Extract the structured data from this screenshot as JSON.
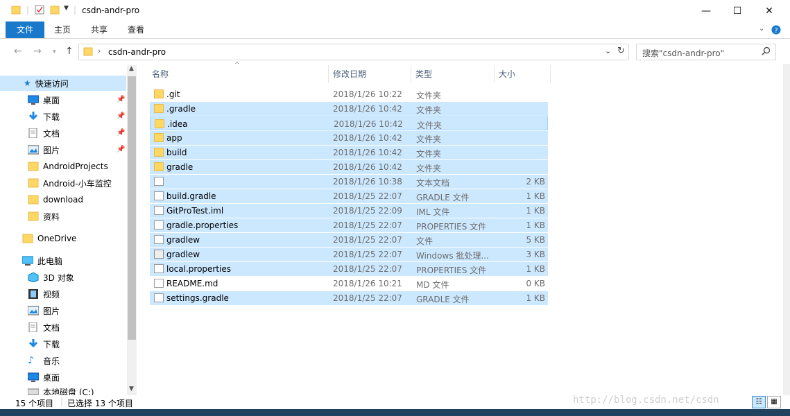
{
  "window": {
    "title": "csdn-andr-pro"
  },
  "title_buttons": {
    "minimize": "—",
    "maximize": "☐",
    "close": "✕"
  },
  "ribbon": {
    "tabs": [
      "文件",
      "主页",
      "共享",
      "查看"
    ]
  },
  "address": {
    "path_label": "csdn-andr-pro",
    "search_placeholder": "搜索\"csdn-andr-pro\""
  },
  "nav": {
    "quick_access": "快速访问",
    "items": [
      {
        "label": "桌面",
        "icon": "desktop-icon",
        "pinned": true
      },
      {
        "label": "下载",
        "icon": "download-icon",
        "pinned": true
      },
      {
        "label": "文档",
        "icon": "documents-icon",
        "pinned": true
      },
      {
        "label": "图片",
        "icon": "pictures-icon",
        "pinned": true
      },
      {
        "label": "AndroidProjects",
        "icon": "folder-icon",
        "pinned": false
      },
      {
        "label": "Android-小车监控",
        "icon": "folder-icon",
        "pinned": false
      },
      {
        "label": "download",
        "icon": "folder-icon",
        "pinned": false
      },
      {
        "label": "资料",
        "icon": "folder-icon",
        "pinned": false
      }
    ],
    "onedrive": "OneDrive",
    "this_pc": "此电脑",
    "pc_items": [
      {
        "label": "3D 对象",
        "icon": "3d-objects-icon"
      },
      {
        "label": "视频",
        "icon": "video-icon"
      },
      {
        "label": "图片",
        "icon": "pictures-icon"
      },
      {
        "label": "文档",
        "icon": "documents-icon"
      },
      {
        "label": "下载",
        "icon": "download-icon"
      },
      {
        "label": "音乐",
        "icon": "music-icon"
      },
      {
        "label": "桌面",
        "icon": "desktop-icon"
      },
      {
        "label": "本地磁盘 (C:)",
        "icon": "drive-icon"
      }
    ]
  },
  "columns": {
    "name": "名称",
    "modified": "修改日期",
    "type": "类型",
    "size": "大小"
  },
  "files": [
    {
      "name": ".git",
      "date": "2018/1/26 10:22",
      "type": "文件夹",
      "size": "",
      "icon": "folder",
      "state": ""
    },
    {
      "name": ".gradle",
      "date": "2018/1/26 10:42",
      "type": "文件夹",
      "size": "",
      "icon": "folder",
      "state": "sel"
    },
    {
      "name": ".idea",
      "date": "2018/1/26 10:42",
      "type": "文件夹",
      "size": "",
      "icon": "folder",
      "state": "focus"
    },
    {
      "name": "app",
      "date": "2018/1/26 10:42",
      "type": "文件夹",
      "size": "",
      "icon": "folder",
      "state": "sel"
    },
    {
      "name": "build",
      "date": "2018/1/26 10:42",
      "type": "文件夹",
      "size": "",
      "icon": "folder",
      "state": "sel"
    },
    {
      "name": "gradle",
      "date": "2018/1/26 10:42",
      "type": "文件夹",
      "size": "",
      "icon": "folder",
      "state": "sel"
    },
    {
      "name": "",
      "date": "2018/1/26 10:38",
      "type": "文本文档",
      "size": "2 KB",
      "icon": "doc",
      "state": "sel"
    },
    {
      "name": "build.gradle",
      "date": "2018/1/25 22:07",
      "type": "GRADLE 文件",
      "size": "1 KB",
      "icon": "doc",
      "state": "sel"
    },
    {
      "name": "GitProTest.iml",
      "date": "2018/1/25 22:09",
      "type": "IML 文件",
      "size": "1 KB",
      "icon": "doc",
      "state": "sel"
    },
    {
      "name": "gradle.properties",
      "date": "2018/1/25 22:07",
      "type": "PROPERTIES 文件",
      "size": "1 KB",
      "icon": "doc",
      "state": "sel"
    },
    {
      "name": "gradlew",
      "date": "2018/1/25 22:07",
      "type": "文件",
      "size": "5 KB",
      "icon": "doc",
      "state": "sel"
    },
    {
      "name": "gradlew",
      "date": "2018/1/25 22:07",
      "type": "Windows 批处理...",
      "size": "3 KB",
      "icon": "bat",
      "state": "sel"
    },
    {
      "name": "local.properties",
      "date": "2018/1/25 22:07",
      "type": "PROPERTIES 文件",
      "size": "1 KB",
      "icon": "doc",
      "state": "sel"
    },
    {
      "name": "README.md",
      "date": "2018/1/26 10:21",
      "type": "MD 文件",
      "size": "0 KB",
      "icon": "doc",
      "state": ""
    },
    {
      "name": "settings.gradle",
      "date": "2018/1/25 22:07",
      "type": "GRADLE 文件",
      "size": "1 KB",
      "icon": "doc",
      "state": "sel"
    }
  ],
  "status": {
    "count": "15 个项目",
    "selected": "已选择 13 个项目"
  },
  "watermark": "http://blog.csdn.net/csdn"
}
